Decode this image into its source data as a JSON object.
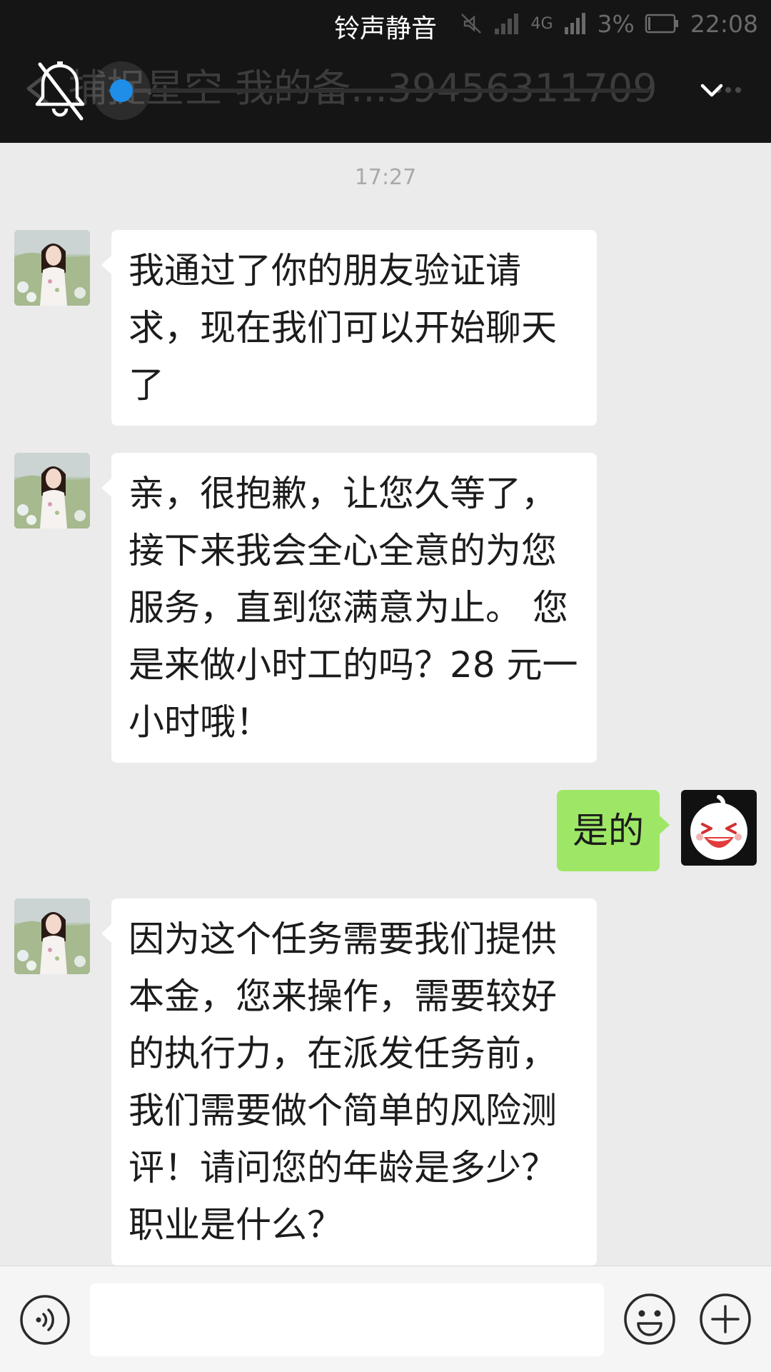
{
  "status_bar": {
    "signal_type": "4G",
    "battery": "3%",
    "time": "22:08"
  },
  "header": {
    "overlay_title": "铃声静音",
    "chat_title": "捕捉星空 我的备...39456311709",
    "ringer_volume_fraction": 0.0
  },
  "chat": {
    "timestamp": "17:27",
    "messages": [
      {
        "side": "left",
        "text": "我通过了你的朋友验证请求，现在我们可以开始聊天了"
      },
      {
        "side": "left",
        "text": "亲，很抱歉，让您久等了，接下来我会全心全意的为您服务，直到您满意为止。 您是来做小时工的吗？28 元一小时哦！"
      },
      {
        "side": "right",
        "text": "是的"
      },
      {
        "side": "left",
        "text": "因为这个任务需要我们提供本金，您来操作，需要较好的执行力，在派发任务前，我们需要做个简单的风险测评！请问您的年龄是多少？职业是什么？"
      }
    ]
  },
  "input_bar": {
    "value": "",
    "icons": [
      "voice-icon",
      "emoji-icon",
      "plus-icon"
    ]
  },
  "colors": {
    "background": "#ebebeb",
    "header": "#151515",
    "accent": "#1e8ee8",
    "outgoing_bubble": "#9ee766",
    "incoming_bubble": "#ffffff"
  }
}
